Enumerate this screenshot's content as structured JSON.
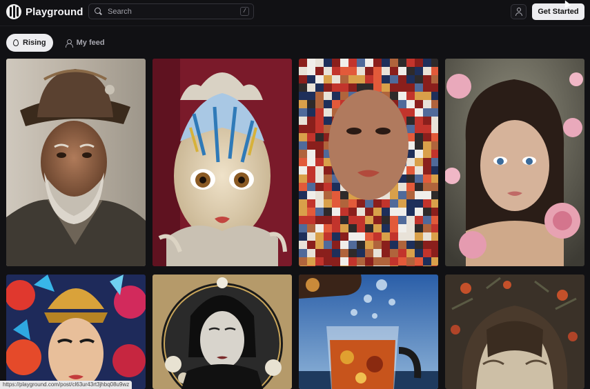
{
  "app": {
    "name": "Playground"
  },
  "search": {
    "placeholder": "Search",
    "shortcut": "/"
  },
  "header": {
    "cta_label": "Get Started"
  },
  "tabs": [
    {
      "label": "Rising",
      "active": true
    },
    {
      "label": "My feed",
      "active": false
    }
  ],
  "gallery": [
    {
      "subject": "portrait of an old bearded miner in a battered hat"
    },
    {
      "subject": "surreal doll face with splattered paint on crimson"
    },
    {
      "subject": "pixel-mosaic portrait of a woman"
    },
    {
      "subject": "fantasy girl portrait among pink roses"
    },
    {
      "subject": "woman with ornate headdress, butterflies and flowers"
    },
    {
      "subject": "monochrome geisha with gold floral frame"
    },
    {
      "subject": "glass of tea with bubbles under a teapot"
    },
    {
      "subject": "face with tangled hair among dark leaves"
    }
  ],
  "status_bar": {
    "url": "https://playground.com/post/cl63ur43rt3jhbq08u9wz"
  },
  "colors": {
    "background": "#111114",
    "accent_button": "#ededf0"
  }
}
